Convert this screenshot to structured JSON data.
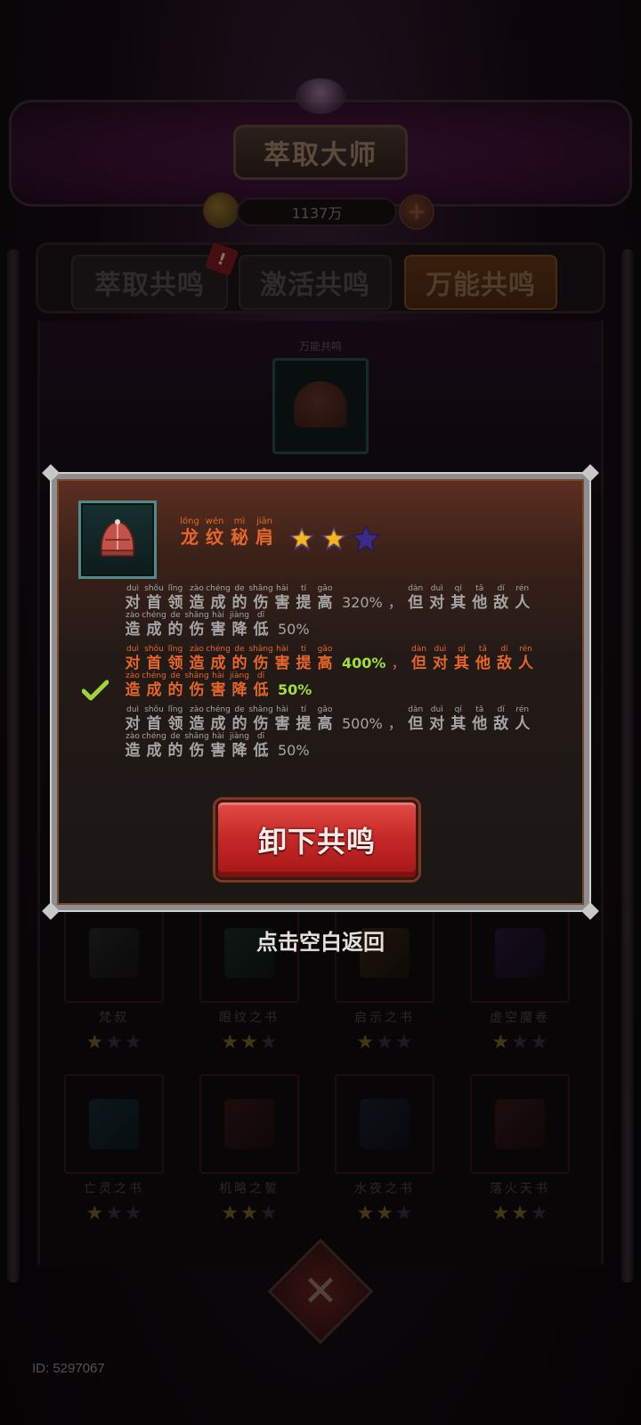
{
  "header": {
    "title": "萃取大师",
    "currency_amount": "1137万"
  },
  "tabs": [
    {
      "label": "萃取共鸣",
      "active": false
    },
    {
      "label": "激活共鸣",
      "active": false
    },
    {
      "label": "万能共鸣",
      "active": true
    }
  ],
  "center_slot": {
    "label": "万能共鸣"
  },
  "grid_items": [
    {
      "name": "梵叔",
      "stars": 1,
      "icon": "staff-icon"
    },
    {
      "name": "眼纹之书",
      "stars": 2,
      "icon": "book-icon"
    },
    {
      "name": "启示之书",
      "stars": 1,
      "icon": "scroll-icon"
    },
    {
      "name": "虚空魔卷",
      "stars": 1,
      "icon": "tome-icon"
    },
    {
      "name": "亡灵之书",
      "stars": 1,
      "icon": "book-icon"
    },
    {
      "name": "机略之誓",
      "stars": 2,
      "icon": "book-icon"
    },
    {
      "name": "水夜之书",
      "stars": 2,
      "icon": "book-icon"
    },
    {
      "name": "落火天书",
      "stars": 2,
      "icon": "book-icon"
    }
  ],
  "popup": {
    "item_name": [
      {
        "hz": "龙",
        "py": "lóng"
      },
      {
        "hz": "纹",
        "py": "wén"
      },
      {
        "hz": "秘",
        "py": "mì"
      },
      {
        "hz": "肩",
        "py": "jiān"
      }
    ],
    "stars": {
      "filled": 2,
      "total": 3
    },
    "descriptions": [
      {
        "selected": false,
        "line1_a": [
          {
            "hz": "对",
            "py": "duì"
          },
          {
            "hz": "首",
            "py": "shǒu"
          },
          {
            "hz": "领",
            "py": "lǐng"
          },
          {
            "hz": "造",
            "py": "zào"
          },
          {
            "hz": "成",
            "py": "chéng"
          },
          {
            "hz": "的",
            "py": "de"
          },
          {
            "hz": "伤",
            "py": "shāng"
          },
          {
            "hz": "害",
            "py": "hài"
          },
          {
            "hz": "提",
            "py": "tí"
          },
          {
            "hz": "高",
            "py": "gāo"
          }
        ],
        "value1": "320%",
        "comma": "，",
        "line1_b": [
          {
            "hz": "但",
            "py": "dàn"
          },
          {
            "hz": "对",
            "py": "duì"
          },
          {
            "hz": "其",
            "py": "qí"
          },
          {
            "hz": "他",
            "py": "tā"
          },
          {
            "hz": "敌",
            "py": "dí"
          },
          {
            "hz": "人",
            "py": "rén"
          }
        ],
        "line2": [
          {
            "hz": "造",
            "py": "zào"
          },
          {
            "hz": "成",
            "py": "chéng"
          },
          {
            "hz": "的",
            "py": "de"
          },
          {
            "hz": "伤",
            "py": "shāng"
          },
          {
            "hz": "害",
            "py": "hài"
          },
          {
            "hz": "降",
            "py": "jiàng"
          },
          {
            "hz": "低",
            "py": "dī"
          }
        ],
        "value2": "50%"
      },
      {
        "selected": true,
        "line1_a": [
          {
            "hz": "对",
            "py": "duì"
          },
          {
            "hz": "首",
            "py": "shǒu"
          },
          {
            "hz": "领",
            "py": "lǐng"
          },
          {
            "hz": "造",
            "py": "zào"
          },
          {
            "hz": "成",
            "py": "chéng"
          },
          {
            "hz": "的",
            "py": "de"
          },
          {
            "hz": "伤",
            "py": "shāng"
          },
          {
            "hz": "害",
            "py": "hài"
          },
          {
            "hz": "提",
            "py": "tí"
          },
          {
            "hz": "高",
            "py": "gāo"
          }
        ],
        "value1": "400%",
        "comma": "，",
        "line1_b": [
          {
            "hz": "但",
            "py": "dàn"
          },
          {
            "hz": "对",
            "py": "duì"
          },
          {
            "hz": "其",
            "py": "qí"
          },
          {
            "hz": "他",
            "py": "tā"
          },
          {
            "hz": "敌",
            "py": "dí"
          },
          {
            "hz": "人",
            "py": "rén"
          }
        ],
        "line2": [
          {
            "hz": "造",
            "py": "zào"
          },
          {
            "hz": "成",
            "py": "chéng"
          },
          {
            "hz": "的",
            "py": "de"
          },
          {
            "hz": "伤",
            "py": "shāng"
          },
          {
            "hz": "害",
            "py": "hài"
          },
          {
            "hz": "降",
            "py": "jiàng"
          },
          {
            "hz": "低",
            "py": "dī"
          }
        ],
        "value2": "50%"
      },
      {
        "selected": false,
        "line1_a": [
          {
            "hz": "对",
            "py": "duì"
          },
          {
            "hz": "首",
            "py": "shǒu"
          },
          {
            "hz": "领",
            "py": "lǐng"
          },
          {
            "hz": "造",
            "py": "zào"
          },
          {
            "hz": "成",
            "py": "chéng"
          },
          {
            "hz": "的",
            "py": "de"
          },
          {
            "hz": "伤",
            "py": "shāng"
          },
          {
            "hz": "害",
            "py": "hài"
          },
          {
            "hz": "提",
            "py": "tí"
          },
          {
            "hz": "高",
            "py": "gāo"
          }
        ],
        "value1": "500%",
        "comma": "，",
        "line1_b": [
          {
            "hz": "但",
            "py": "dàn"
          },
          {
            "hz": "对",
            "py": "duì"
          },
          {
            "hz": "其",
            "py": "qí"
          },
          {
            "hz": "他",
            "py": "tā"
          },
          {
            "hz": "敌",
            "py": "dí"
          },
          {
            "hz": "人",
            "py": "rén"
          }
        ],
        "line2": [
          {
            "hz": "造",
            "py": "zào"
          },
          {
            "hz": "成",
            "py": "chéng"
          },
          {
            "hz": "的",
            "py": "de"
          },
          {
            "hz": "伤",
            "py": "shāng"
          },
          {
            "hz": "害",
            "py": "hài"
          },
          {
            "hz": "降",
            "py": "jiàng"
          },
          {
            "hz": "低",
            "py": "dī"
          }
        ],
        "value2": "50%"
      }
    ],
    "unequip_label": "卸下共鸣"
  },
  "return_hint": "点击空白返回",
  "footer_id": "ID: 5297067",
  "colors": {
    "accent_orange": "#e8662a",
    "highlight_green": "#a5e03a",
    "button_red": "#c72a28",
    "star_gold": "#f0b626",
    "star_empty": "#3a2a8a"
  },
  "icons": {
    "item": "helmet-icon",
    "selected": "check-icon",
    "coin": "coin-icon",
    "add": "add-icon",
    "close": "close-icon"
  }
}
